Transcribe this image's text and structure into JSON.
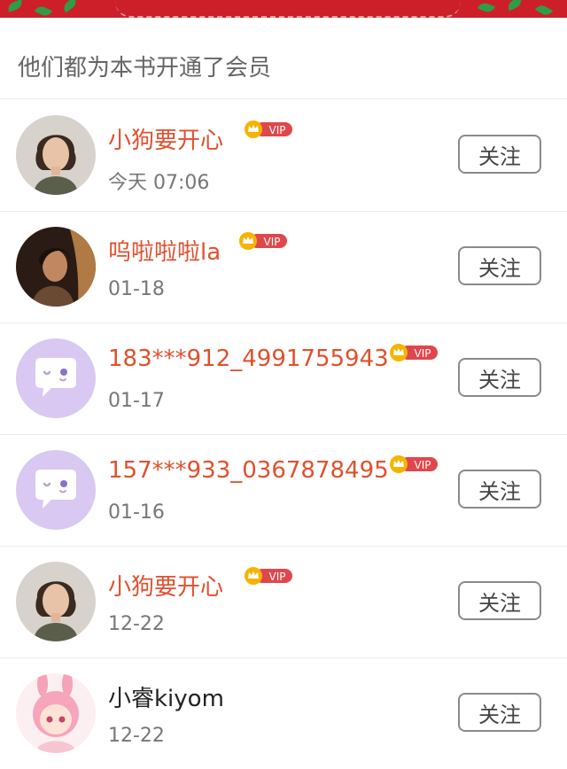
{
  "section": {
    "title": "他们都为本书开通了会员"
  },
  "vip_badge": {
    "label": "VIP",
    "color": "#e0474c",
    "crown_color": "#f5b400"
  },
  "colors": {
    "banner": "#cc1f2a",
    "name_vip": "#e0502e",
    "name_plain": "#222222"
  },
  "members": [
    {
      "name": "小狗要开心",
      "time": "今天 07:06",
      "vip": true,
      "avatar": "photo-woman-1",
      "follow_label": "关注"
    },
    {
      "name": "呜啦啦啦la",
      "time": "01-18",
      "vip": true,
      "avatar": "photo-woman-2",
      "follow_label": "关注"
    },
    {
      "name": "183***912_4991755943",
      "time": "01-17",
      "vip": true,
      "avatar": "default-chat-avatar",
      "follow_label": "关注"
    },
    {
      "name": "157***933_0367878495",
      "time": "01-16",
      "vip": true,
      "avatar": "default-chat-avatar",
      "follow_label": "关注"
    },
    {
      "name": "小狗要开心",
      "time": "12-22",
      "vip": true,
      "avatar": "photo-woman-1",
      "follow_label": "关注"
    },
    {
      "name": "小睿kiyom",
      "time": "12-22",
      "vip": false,
      "avatar": "anime-pink-girl",
      "follow_label": "关注"
    }
  ]
}
